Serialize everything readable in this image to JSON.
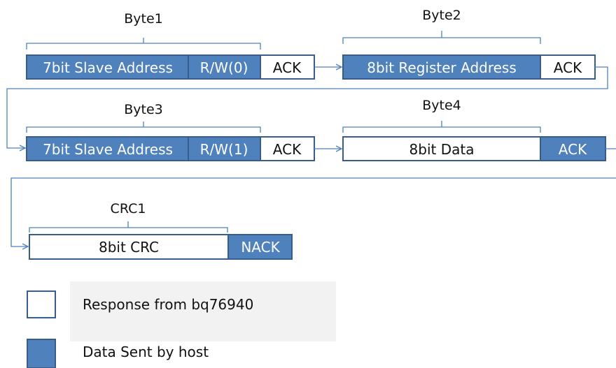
{
  "colors": {
    "host_fill": "#4f81bd",
    "host_border": "#385d8a",
    "response_fill": "#ffffff",
    "line": "#4f81bd"
  },
  "rows": {
    "byte1": {
      "label": "Byte1",
      "address": "7bit Slave Address",
      "rw": "R/W(0)",
      "ack": "ACK"
    },
    "byte2": {
      "label": "Byte2",
      "data": "8bit Register Address",
      "ack": "ACK"
    },
    "byte3": {
      "label": "Byte3",
      "address": "7bit Slave Address",
      "rw": "R/W(1)",
      "ack": "ACK"
    },
    "byte4": {
      "label": "Byte4",
      "data": "8bit Data",
      "ack": "ACK"
    },
    "crc1": {
      "label": "CRC1",
      "data": "8bit CRC",
      "nack": "NACK"
    }
  },
  "legend": {
    "response": "Response from bq76940",
    "host": "Data Sent by host"
  }
}
